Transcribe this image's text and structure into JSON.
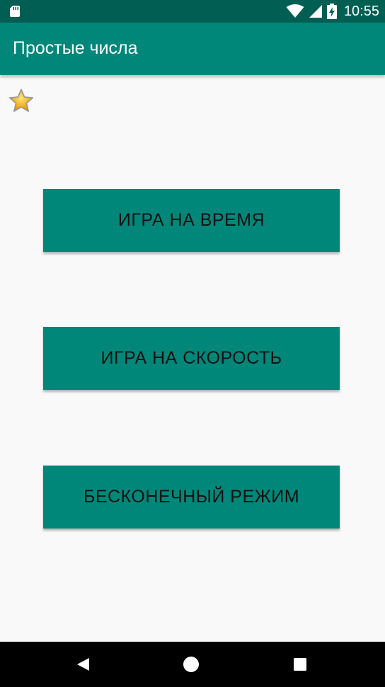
{
  "status_bar": {
    "time": "10:55",
    "icons": [
      "sd-card-icon",
      "wifi-icon",
      "signal-icon",
      "battery-charging-icon"
    ]
  },
  "app_bar": {
    "title": "Простые числа"
  },
  "favorites": {
    "icon": "star-icon"
  },
  "buttons": {
    "timed_game": "ИГРА НА ВРЕМЯ",
    "speed_game": "ИГРА НА СКОРОСТЬ",
    "endless_mode": "БЕСКОНЕЧНЫЙ РЕЖИМ"
  },
  "navigation": {
    "icons": [
      "back-icon",
      "home-icon",
      "recents-icon"
    ]
  },
  "colors": {
    "primary": "#00877a",
    "primary_dark": "#005f52",
    "background": "#f9f9f9",
    "button_text": "#111111"
  }
}
